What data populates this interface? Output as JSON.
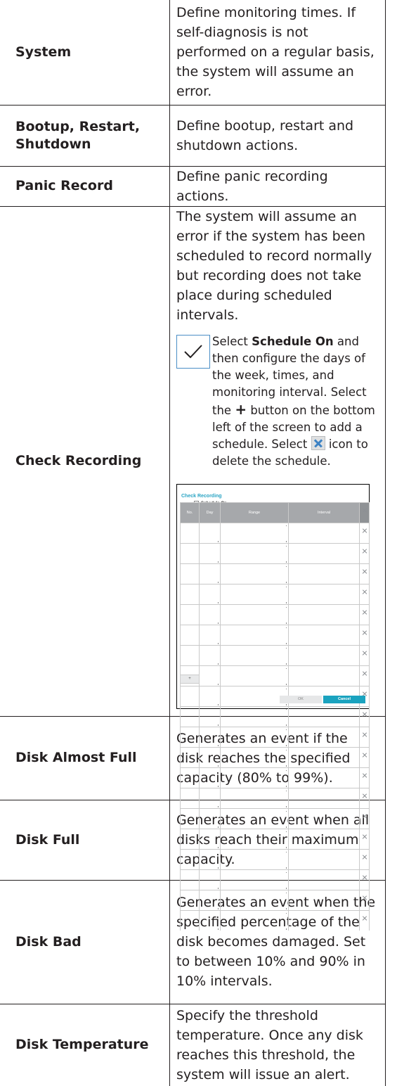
{
  "rows": [
    {
      "label": "System",
      "desc": "Define monitoring times. If self-diagnosis is not performed on a regular basis, the system will assume an error."
    },
    {
      "label": "Bootup, Restart, Shutdown",
      "desc": "Define bootup, restart and shutdown actions."
    },
    {
      "label": "Panic Record",
      "desc": "Define panic recording actions."
    },
    {
      "label": "Check Recording",
      "desc": "The system will assume an error if the system has been scheduled to record normally but recording does not take place during scheduled intervals."
    },
    {
      "label": "Disk Almost Full",
      "desc": "Generates an event if the disk reaches the specified capacity (80% to 99%)."
    },
    {
      "label": "Disk Full",
      "desc": "Generates an event when all disks reach their maximum capacity."
    },
    {
      "label": "Disk Bad",
      "desc": "Generates an event when the specified percentage of the disk becomes damaged. Set to between 10% and 90% in 10% intervals."
    },
    {
      "label": "Disk Temperature",
      "desc": "Specify the threshold temperature. Once any disk reaches this threshold, the system will issue an alert."
    }
  ],
  "note": {
    "part1": "Select ",
    "bold": "Schedule On",
    "part2": " and then configure the days of the week, times, and monitoring interval. Select the ",
    "plus_glyph": "+",
    "part3": " button on the bottom left of the screen to add a schedule. Select ",
    "part4": " icon to delete the schedule.",
    "check_icon": "checkmark-icon",
    "delete_icon": "close-icon"
  },
  "screenshot": {
    "title": "Check Recording",
    "schedule_label": "Schedule On",
    "columns": [
      "No.",
      "Day",
      "Range",
      "Interval"
    ],
    "add_button": "+",
    "ok_button": "OK",
    "cancel_button": "Cancel",
    "accent": "#1aa3bf"
  }
}
